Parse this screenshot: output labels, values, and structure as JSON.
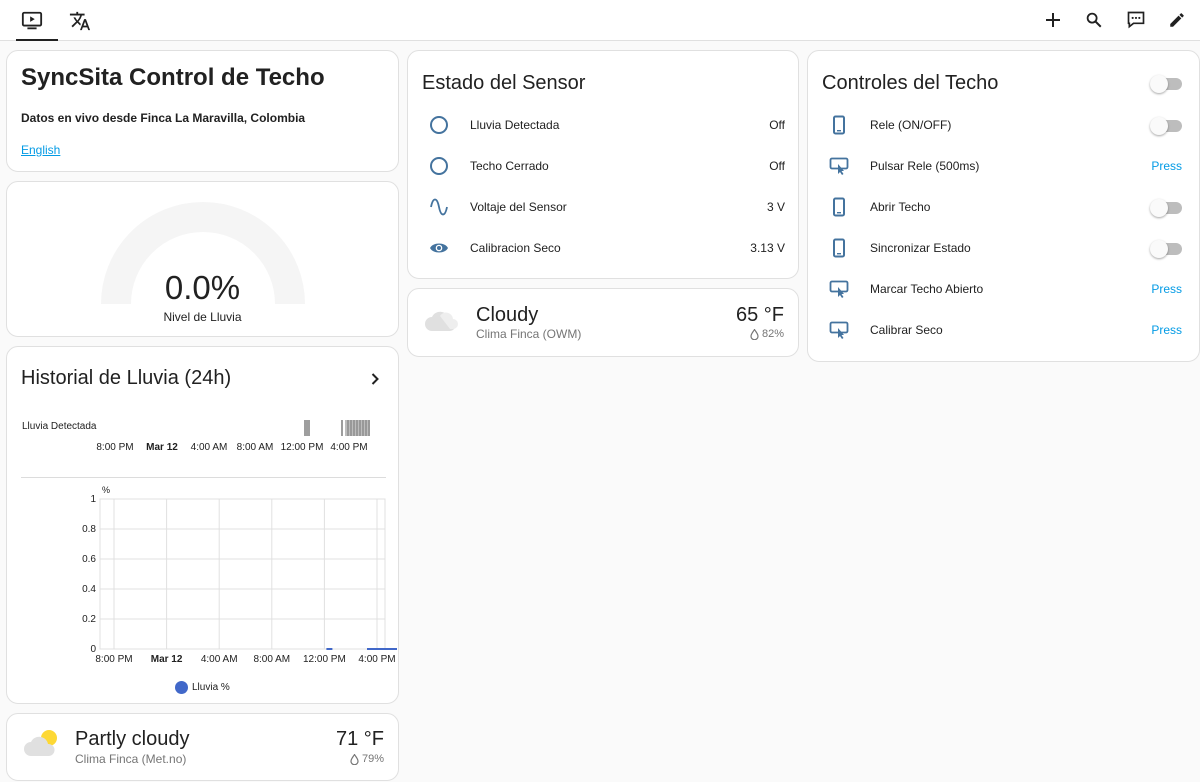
{
  "header": {
    "tabs": [
      {
        "name": "overview",
        "icon": "monitor-play-icon",
        "active": true
      },
      {
        "name": "translate",
        "icon": "translate-icon",
        "active": false
      }
    ],
    "actions": [
      "plus-icon",
      "magnify-icon",
      "comment-processing-icon",
      "pencil-icon"
    ]
  },
  "markdown": {
    "title": "SyncSita Control de Techo",
    "subtitle": "Datos en vivo desde Finca La Maravilla, Colombia",
    "link": "English"
  },
  "gauge": {
    "value": "0.0%",
    "value_fraction": 0.0,
    "name": "Nivel de Lluvia"
  },
  "history": {
    "title": "Historial de Lluvia (24h)",
    "timeline_label": "Lluvia Detectada",
    "time_ticks": [
      "8:00 PM",
      "Mar 12",
      "4:00 AM",
      "8:00 AM",
      "12:00 PM",
      "4:00 PM"
    ],
    "unit": "%",
    "legend": "Lluvia %"
  },
  "chart_data": {
    "type": "line",
    "title": "Historial de Lluvia (24h)",
    "ylabel": "%",
    "ylim": [
      0,
      1
    ],
    "y_ticks": [
      "1",
      "0.8",
      "0.6",
      "0.4",
      "0.2",
      "0"
    ],
    "x_ticks": [
      "8:00 PM",
      "Mar 12",
      "4:00 AM",
      "8:00 AM",
      "12:00 PM",
      "4:00 PM"
    ],
    "series": [
      {
        "name": "Lluvia %",
        "color": "#4168c9",
        "values": [
          0,
          0,
          0,
          0,
          0,
          0
        ]
      }
    ]
  },
  "sensor": {
    "title": "Estado del Sensor",
    "rows": [
      {
        "icon": "circle-outline-icon",
        "name": "Lluvia Detectada",
        "state": "Off"
      },
      {
        "icon": "circle-outline-icon",
        "name": "Techo Cerrado",
        "state": "Off"
      },
      {
        "icon": "sine-wave-icon",
        "name": "Voltaje del Sensor",
        "state": "3 V"
      },
      {
        "icon": "eye-icon",
        "name": "Calibracion Seco",
        "state": "3.13 V"
      }
    ]
  },
  "weather_owm": {
    "condition": "Cloudy",
    "name": "Clima Finca (OWM)",
    "temperature": "65 °F",
    "humidity": "82%"
  },
  "controls": {
    "title": "Controles del Techo",
    "rows": [
      {
        "icon": "phone-icon",
        "name": "Rele (ON/OFF)",
        "type": "toggle",
        "on": false
      },
      {
        "icon": "gesture-tap-button-icon",
        "name": "Pulsar Rele (500ms)",
        "type": "button",
        "action": "Press"
      },
      {
        "icon": "phone-icon",
        "name": "Abrir Techo",
        "type": "toggle",
        "on": false
      },
      {
        "icon": "phone-icon",
        "name": "Sincronizar Estado",
        "type": "toggle",
        "on": false
      },
      {
        "icon": "gesture-tap-button-icon",
        "name": "Marcar Techo Abierto",
        "type": "button",
        "action": "Press"
      },
      {
        "icon": "gesture-tap-button-icon",
        "name": "Calibrar Seco",
        "type": "button",
        "action": "Press"
      }
    ]
  },
  "weather_met": {
    "condition": "Partly cloudy",
    "name": "Clima Finca (Met.no)",
    "temperature": "71 °F",
    "humidity": "79%"
  },
  "colors": {
    "accent": "#039be5",
    "icon": "#44739e",
    "chart_series": "#4168c9",
    "sun": "#fdd835"
  }
}
